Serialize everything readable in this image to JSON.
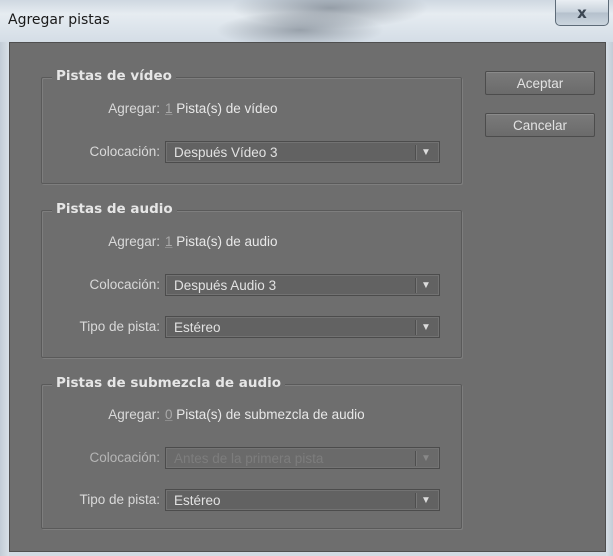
{
  "window": {
    "title": "Agregar pistas",
    "close_glyph": "x"
  },
  "buttons": {
    "accept": "Aceptar",
    "cancel": "Cancelar"
  },
  "video": {
    "title": "Pistas de vídeo",
    "add_label": "Agregar:",
    "add_count": "1",
    "add_suffix": " Pista(s) de vídeo",
    "placement_label": "Colocación:",
    "placement_value": "Después Vídeo 3"
  },
  "audio": {
    "title": "Pistas de audio",
    "add_label": "Agregar:",
    "add_count": "1",
    "add_suffix": " Pista(s) de audio",
    "placement_label": "Colocación:",
    "placement_value": "Después Audio 3",
    "type_label": "Tipo de pista:",
    "type_value": "Estéreo"
  },
  "submix": {
    "title": "Pistas de submezcla de audio",
    "add_label": "Agregar:",
    "add_count": "0",
    "add_suffix": " Pista(s) de submezcla de audio",
    "placement_label": "Colocación:",
    "placement_value": "Antes de la primera pista",
    "type_label": "Tipo de pista:",
    "type_value": "Estéreo"
  },
  "icons": {
    "dropdown": "chevron-down-icon",
    "close": "close-icon"
  }
}
